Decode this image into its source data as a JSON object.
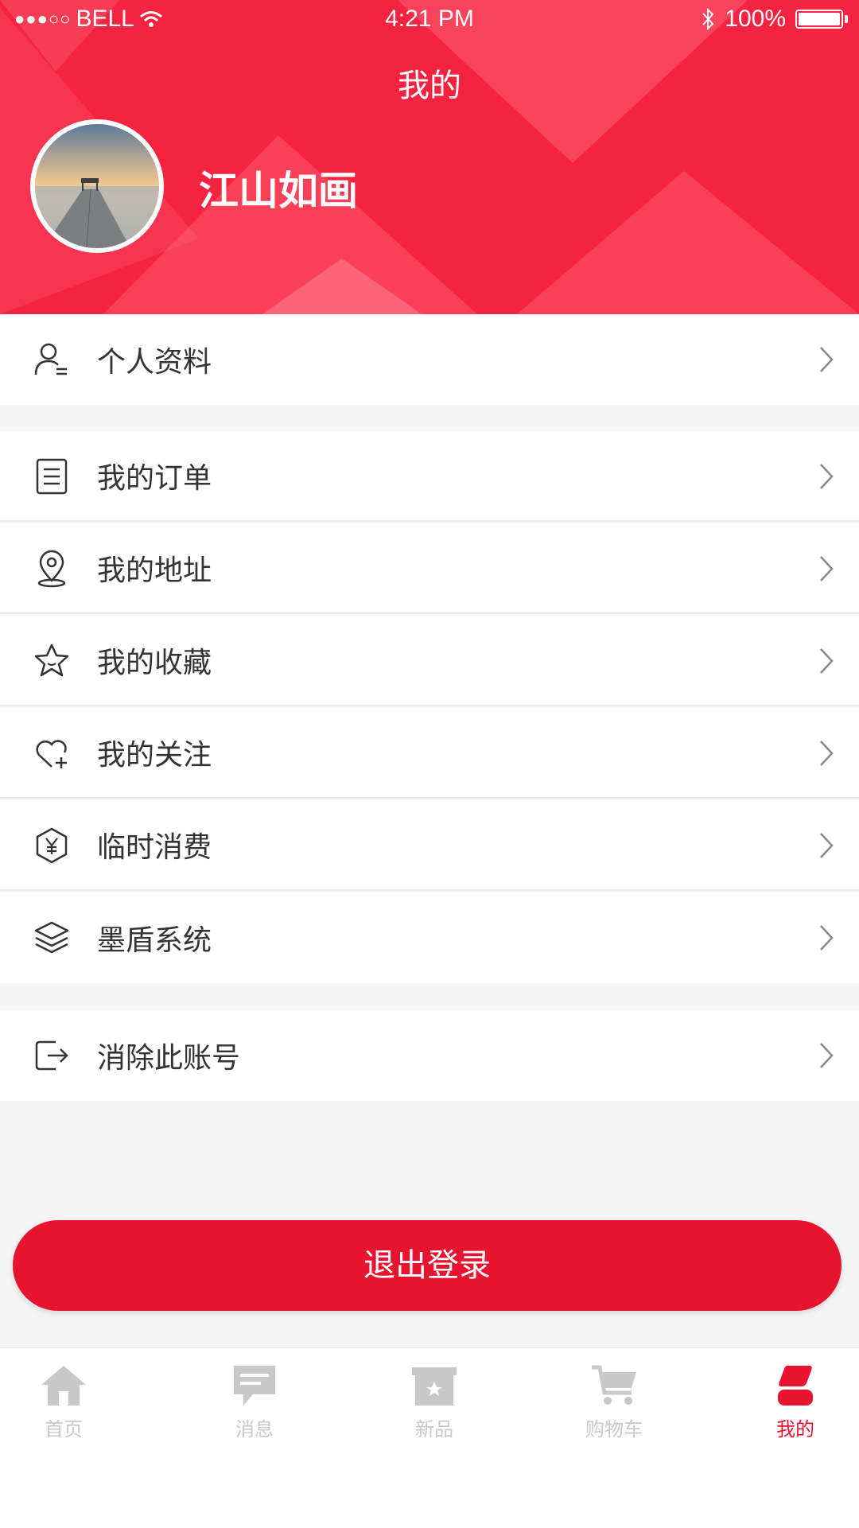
{
  "status_bar": {
    "carrier": "BELL",
    "time": "4:21 PM",
    "battery": "100%"
  },
  "header": {
    "title": "我的",
    "username": "江山如画"
  },
  "menu": {
    "profile": "个人资料",
    "orders": "我的订单",
    "address": "我的地址",
    "favorites": "我的收藏",
    "following": "我的关注",
    "temp_spending": "临时消费",
    "modun_system": "墨盾系统",
    "delete_account": "消除此账号"
  },
  "logout_label": "退出登录",
  "tabbar": {
    "home": "首页",
    "messages": "消息",
    "new_products": "新品",
    "cart": "购物车",
    "mine": "我的"
  },
  "colors": {
    "brand_red": "#e8142f",
    "header_red": "#f5233f",
    "tab_inactive": "#c8c8c8"
  }
}
